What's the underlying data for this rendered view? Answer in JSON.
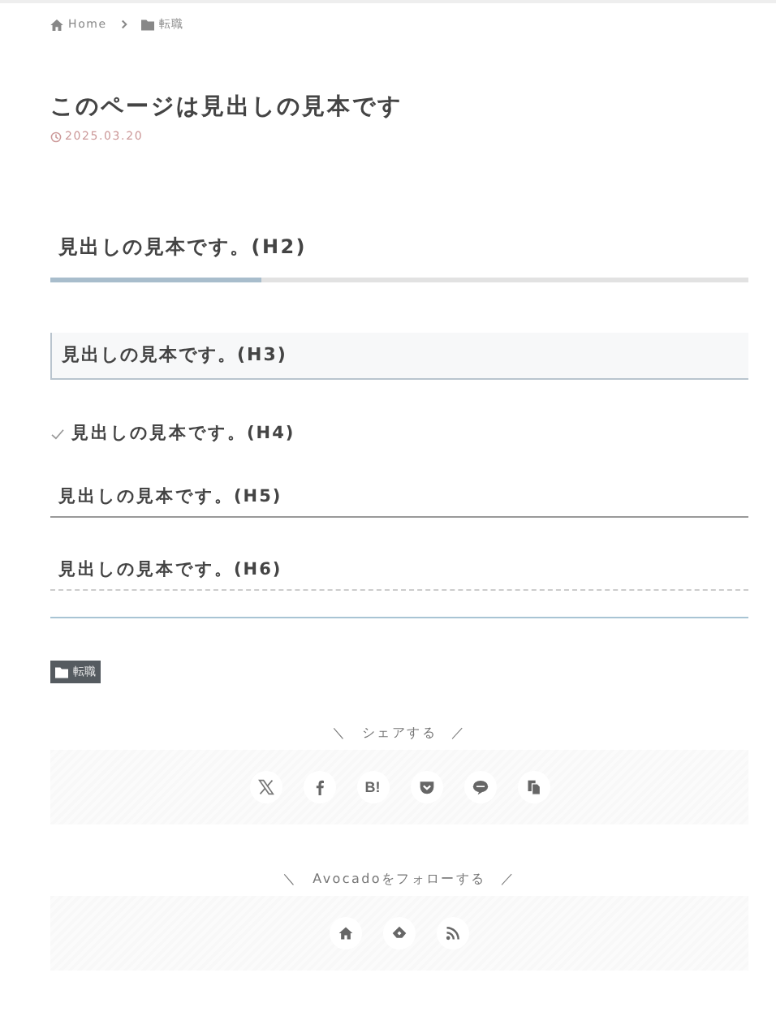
{
  "breadcrumb": [
    {
      "kind": "home",
      "label": "Home"
    },
    {
      "kind": "folder",
      "label": "転職"
    }
  ],
  "title": "このページは見出しの見本です",
  "date": "2025.03.20",
  "headings": [
    {
      "kind": "h2",
      "text": "見出しの見本です。(H2)"
    },
    {
      "kind": "h3",
      "text": "見出しの見本です。(H3)"
    },
    {
      "kind": "h4",
      "text": "見出しの見本です。(H4)"
    },
    {
      "kind": "h5",
      "text": "見出しの見本です。(H5)"
    },
    {
      "kind": "h6",
      "text": "見出しの見本です。(H6)"
    }
  ],
  "category_tag": "転職",
  "share": {
    "heading": "＼　シェアする　／",
    "buttons": [
      {
        "kind": "x"
      },
      {
        "kind": "facebook"
      },
      {
        "kind": "hatena",
        "label": "B!"
      },
      {
        "kind": "pocket"
      },
      {
        "kind": "line"
      },
      {
        "kind": "copy"
      }
    ]
  },
  "follow": {
    "heading": "＼　Avocadoをフォローする　／",
    "buttons": [
      {
        "kind": "home"
      },
      {
        "kind": "feedly"
      },
      {
        "kind": "rss"
      }
    ]
  }
}
